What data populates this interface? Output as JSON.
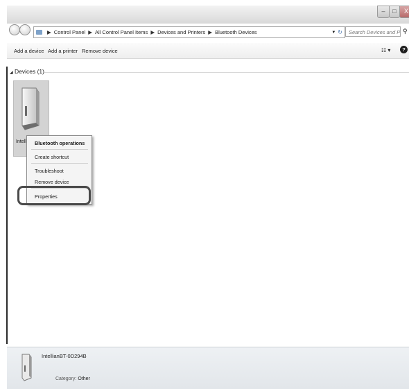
{
  "titlebar": {
    "minimize": "–",
    "maximize": "□",
    "close": "X"
  },
  "address": {
    "crumbs": [
      "Control Panel",
      "All Control Panel Items",
      "Devices and Printers",
      "Bluetooth Devices"
    ]
  },
  "search": {
    "placeholder": "Search Devices and Printers"
  },
  "toolbar": {
    "add_device": "Add a device",
    "add_printer": "Add a printer",
    "remove_device": "Remove device",
    "help": "?"
  },
  "group": {
    "label": "Devices (1)"
  },
  "device": {
    "label": "Intell"
  },
  "context_menu": {
    "items": [
      "Bluetooth operations",
      "Create shortcut",
      "Troubleshoot",
      "Remove device",
      "Properties"
    ]
  },
  "details": {
    "name": "IntellianBT-0D294B",
    "category_label": "Category:",
    "category_value": "Other"
  }
}
